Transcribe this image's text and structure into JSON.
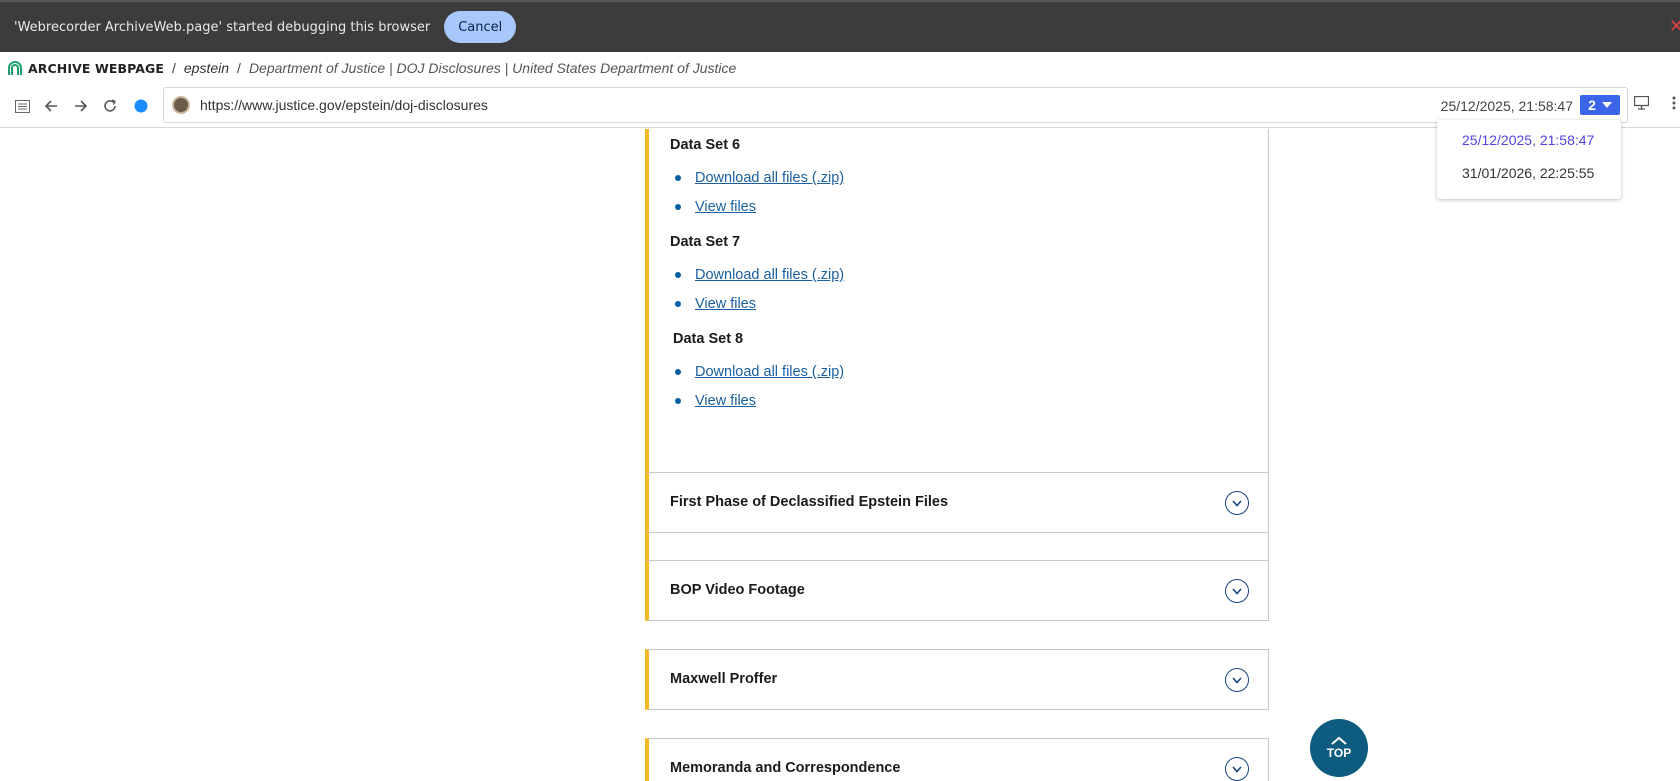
{
  "debug_bar": {
    "message": "'Webrecorder ArchiveWeb.page' started debugging this browser",
    "cancel_label": "Cancel"
  },
  "breadcrumbs": {
    "brand": "ARCHIVE WEBPAGE",
    "separator": "/",
    "collection": "epstein",
    "page_title": "Department of Justice | DOJ Disclosures | United States Department of Justice"
  },
  "nav": {
    "url": "https://www.justice.gov/epstein/doj-disclosures",
    "timestamp": "25/12/2025, 21:58:47",
    "capture_count": "2"
  },
  "timestamp_dropdown": {
    "items": [
      {
        "label": "25/12/2025, 21:58:47",
        "active": true
      },
      {
        "label": "31/01/2026, 22:25:55",
        "active": false
      }
    ]
  },
  "content": {
    "data_sets": [
      {
        "title": "Data Set 6",
        "links": [
          "Download all files (.zip)",
          "View files"
        ]
      },
      {
        "title": "Data Set 7",
        "links": [
          "Download all files (.zip)",
          "View files"
        ]
      },
      {
        "title": "Data Set 8",
        "links": [
          "Download all files (.zip)",
          "View files"
        ]
      }
    ],
    "accordions": [
      {
        "title": "First Phase of Declassified Epstein Files"
      },
      {
        "title": "BOP Video Footage"
      },
      {
        "title": "Maxwell Proffer"
      },
      {
        "title": "Memoranda and Correspondence"
      }
    ],
    "top_label": "TOP"
  },
  "colors": {
    "accent_border": "#f2b827",
    "link": "#1a5fa0",
    "top_button": "#0d5c7f",
    "count_badge": "#3b64e8",
    "active_dropdown_item": "#4f46e5"
  }
}
